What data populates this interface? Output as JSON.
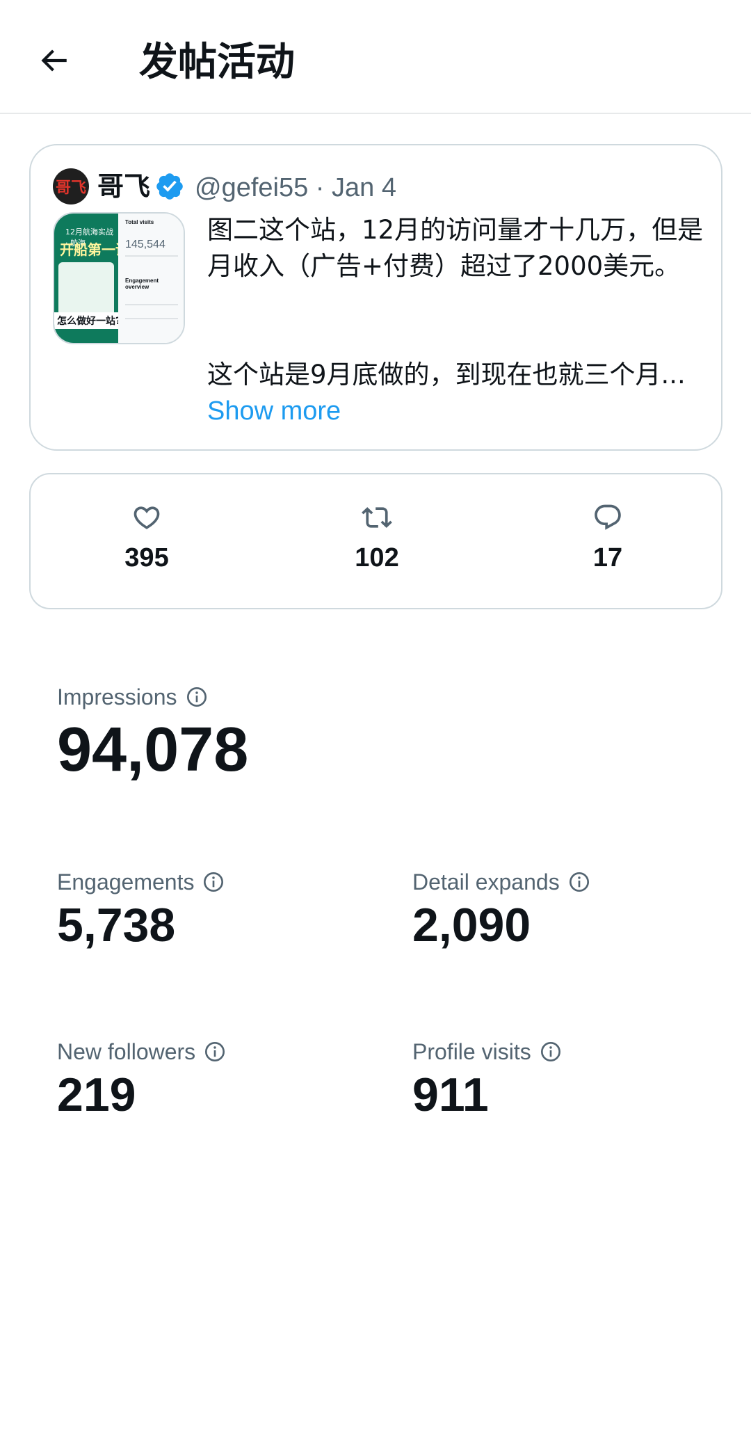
{
  "header": {
    "title": "发帖活动",
    "back_icon": "arrow-left-icon"
  },
  "post": {
    "avatar_text": "哥飞",
    "author_name": "哥飞",
    "handle_date": "@gefei55 · Jan 4",
    "text_line1": "图二这个站，12月的访问量才十几万，但是月收入（广告+付费）超过了2000美元。",
    "text_line2": "这个站是9月底做的，到现在也就三个月...",
    "show_more": "Show more",
    "thumbnail": {
      "banner_small": "12月航海实战 · 航海",
      "banner_big": "开船第一课",
      "bottom_text": "怎么做好一站?",
      "right_title": "Total visits",
      "right_value": "145,544",
      "right_subtitle": "Engagement overview"
    }
  },
  "engagement": {
    "likes": "395",
    "retweets": "102",
    "replies": "17"
  },
  "metrics": {
    "impressions": {
      "label": "Impressions",
      "value": "94,078"
    },
    "engagements": {
      "label": "Engagements",
      "value": "5,738"
    },
    "detail_expands": {
      "label": "Detail expands",
      "value": "2,090"
    },
    "new_followers": {
      "label": "New followers",
      "value": "219"
    },
    "profile_visits": {
      "label": "Profile visits",
      "value": "911"
    }
  },
  "colors": {
    "accent": "#1d9bf0",
    "secondary_text": "#536471",
    "border": "#cfd9de"
  }
}
